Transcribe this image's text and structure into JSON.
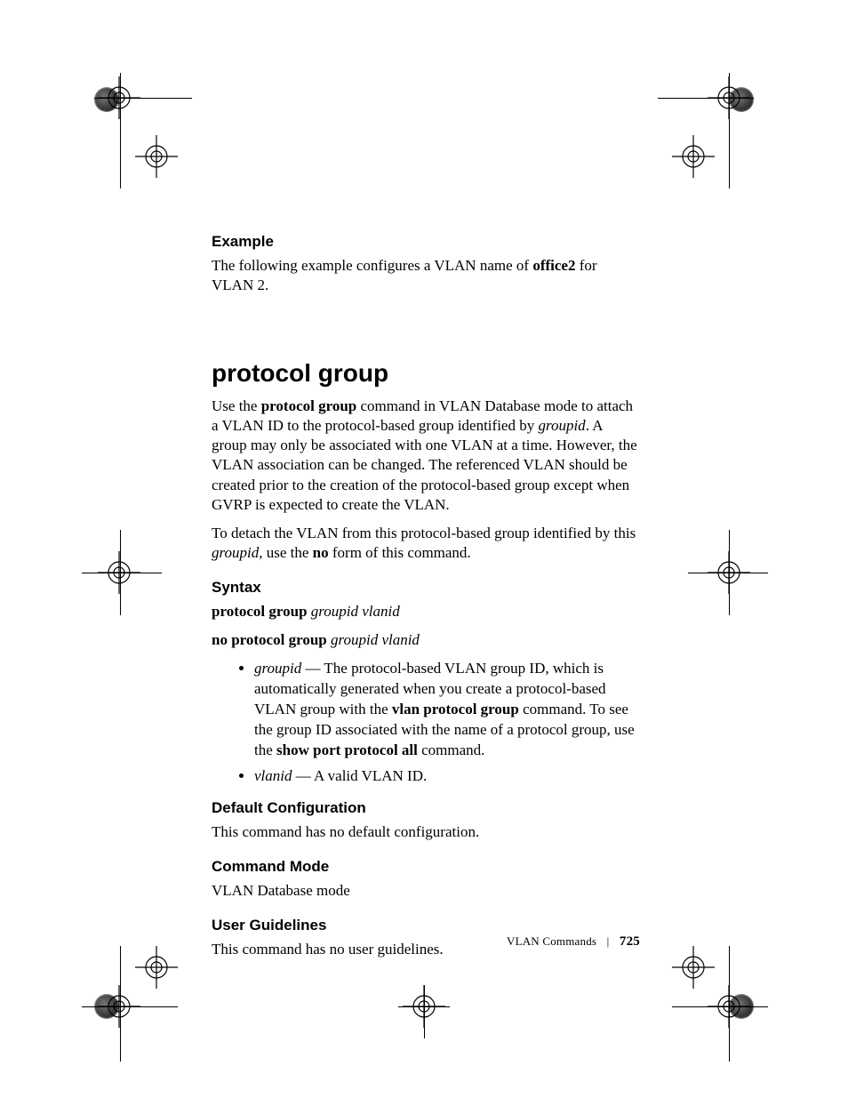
{
  "example": {
    "heading": "Example",
    "text_plain": "The following example configures a VLAN name of ",
    "bold1": "office2",
    "text_tail": " for VLAN 2."
  },
  "section": {
    "title": "protocol group",
    "para1_pre": "Use the ",
    "para1_b1": "protocol group",
    "para1_mid": " command in VLAN Database mode to attach a VLAN ID to the protocol-based group identified by ",
    "para1_i1": "groupid",
    "para1_tail": ". A group may only be associated with one VLAN at a time. However, the VLAN association can be changed. The referenced VLAN should be created prior to the creation of the protocol-based group except when GVRP is expected to create the VLAN.",
    "para2_pre": "To detach the VLAN from this protocol-based group identified by this ",
    "para2_i1": "groupid",
    "para2_mid": ", use the ",
    "para2_b1": "no",
    "para2_tail": " form of this command."
  },
  "syntax": {
    "heading": "Syntax",
    "line1_b": "protocol group ",
    "line1_i": "groupid vlanid",
    "line2_b": "no protocol group ",
    "line2_i": "groupid vlanid",
    "bullet1_i": "groupid",
    "bullet1_pre": " — The protocol-based VLAN group ID, which is automatically generated when you create a protocol-based VLAN group with the ",
    "bullet1_b1": "vlan protocol group",
    "bullet1_mid": " command. To see the group ID associated with the name of a protocol group, use the ",
    "bullet1_b2": "show port protocol all",
    "bullet1_tail": " command.",
    "bullet2_i": "vlanid",
    "bullet2_tail": " — A valid VLAN ID."
  },
  "defaultcfg": {
    "heading": "Default Configuration",
    "text": "This command has no default configuration."
  },
  "cmdmode": {
    "heading": "Command Mode",
    "text": "VLAN Database mode"
  },
  "userg": {
    "heading": "User Guidelines",
    "text": "This command has no user guidelines."
  },
  "footer": {
    "section": "VLAN Commands",
    "page": "725"
  }
}
